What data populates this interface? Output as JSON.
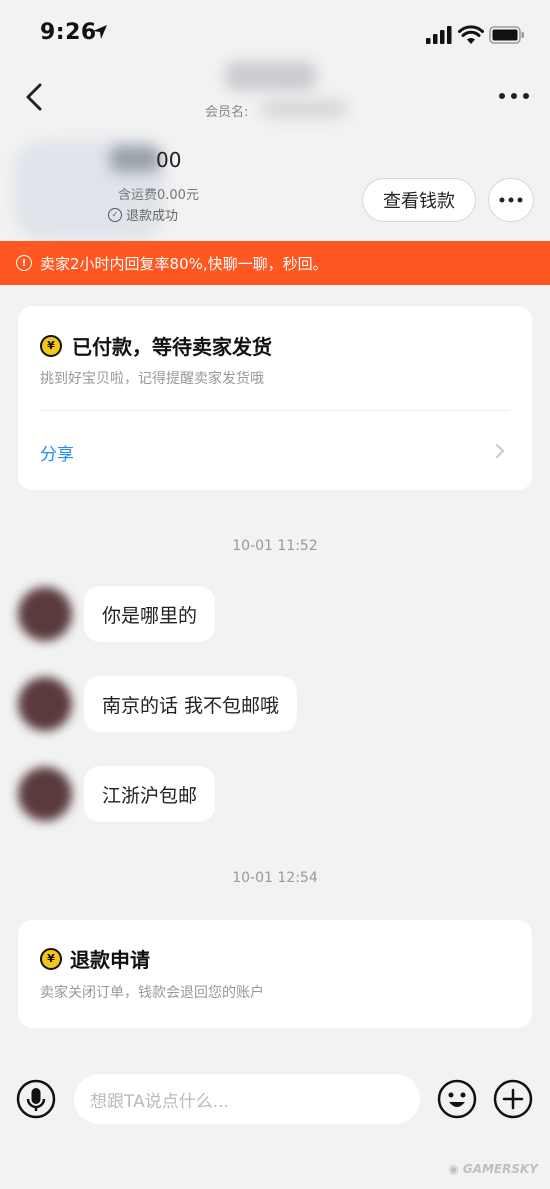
{
  "status_bar": {
    "time": "9:26"
  },
  "nav": {
    "member_label": "会员名:"
  },
  "product": {
    "price_partial": "00",
    "shipping": "含运费0.00元",
    "refund_status": "退款成功",
    "view_money_label": "查看钱款"
  },
  "notice": {
    "text": "卖家2小时内回复率80%,快聊一聊，秒回。"
  },
  "order_card": {
    "title": "已付款，等待卖家发货",
    "subtitle": "挑到好宝贝啦，记得提醒卖家发货哦",
    "share_label": "分享"
  },
  "chat": {
    "timestamp_1": "10-01 11:52",
    "messages": [
      "你是哪里的",
      "南京的话 我不包邮哦",
      "江浙沪包邮"
    ],
    "timestamp_2": "10-01 12:54"
  },
  "refund_card": {
    "title": "退款申请",
    "subtitle": "卖家关闭订单，钱款会退回您的账户"
  },
  "input_bar": {
    "placeholder": "想跟TA说点什么..."
  },
  "watermark": {
    "text": "GAMERSKY"
  },
  "colors": {
    "notice_bg": "#ff5722",
    "link": "#1a8dff",
    "coin": "#f5c518"
  }
}
